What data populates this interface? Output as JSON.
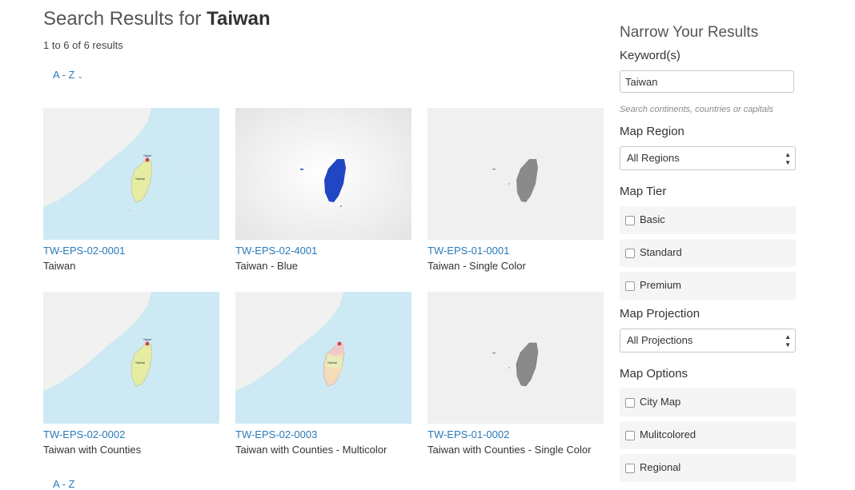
{
  "header": {
    "prefix": "Search Results for",
    "query": "Taiwan",
    "count_text": "1 to 6 of 6 results"
  },
  "sort": {
    "label": "A - Z",
    "bottom_label": "A - Z"
  },
  "colors": {
    "link": "#2a7ab8",
    "sea": "#cdeaf4",
    "land_gray": "#f1f1f1",
    "taiwan_yellow": "#e6eca2",
    "taiwan_blue": "#2146c4",
    "taiwan_gray": "#8a8a8a"
  },
  "results": [
    {
      "code": "TW-EPS-02-0001",
      "title": "Taiwan",
      "thumb_style": "labeled-yellow",
      "label": "Taiwan",
      "capital": "Taipei"
    },
    {
      "code": "TW-EPS-02-4001",
      "title": "Taiwan - Blue",
      "thumb_style": "blue"
    },
    {
      "code": "TW-EPS-01-0001",
      "title": "Taiwan - Single Color",
      "thumb_style": "gray"
    },
    {
      "code": "TW-EPS-02-0002",
      "title": "Taiwan with Counties",
      "thumb_style": "labeled-yellow",
      "label": "Taiwan",
      "capital": "Taipei"
    },
    {
      "code": "TW-EPS-02-0003",
      "title": "Taiwan with Counties - Multicolor",
      "thumb_style": "multicolor",
      "label": "Taiwan"
    },
    {
      "code": "TW-EPS-01-0002",
      "title": "Taiwan with Counties - Single Color",
      "thumb_style": "gray"
    }
  ],
  "sidebar": {
    "heading": "Narrow Your Results",
    "keyword_label": "Keyword(s)",
    "keyword_value": "Taiwan",
    "keyword_hint": "Search continents, countries or capitals",
    "region_label": "Map Region",
    "region_value": "All Regions",
    "tier_label": "Map Tier",
    "tiers": [
      "Basic",
      "Standard",
      "Premium"
    ],
    "projection_label": "Map Projection",
    "projection_value": "All Projections",
    "options_label": "Map Options",
    "options": [
      "City Map",
      "Mulitcolored",
      "Regional"
    ]
  }
}
